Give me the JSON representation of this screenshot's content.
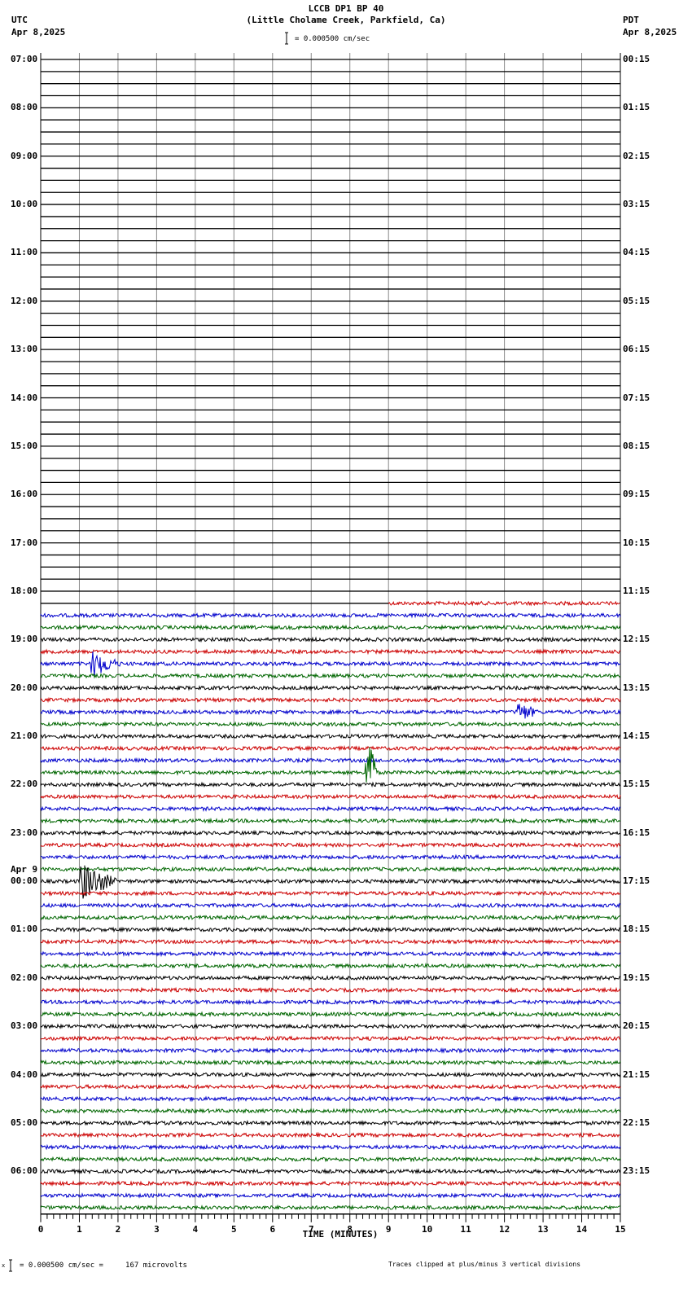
{
  "header": {
    "title": "LCCB DP1 BP 40",
    "subtitle": "(Little Cholame Creek, Parkfield, Ca)",
    "left_tz": "UTC",
    "left_date": "Apr 8,2025",
    "right_tz": "PDT",
    "right_date": "Apr 8,2025",
    "scale": "= 0.000500 cm/sec"
  },
  "footer": {
    "scale": "= 0.000500 cm/sec =     167 microvolts",
    "scale_prefix": "x",
    "clip_note": "Traces clipped at plus/minus 3 vertical divisions"
  },
  "chart_data": {
    "type": "line",
    "title": "LCCB DP1 BP 40",
    "xlabel": "TIME (MINUTES)",
    "xlim": [
      0,
      15
    ],
    "x_ticks": [
      "0",
      "1",
      "2",
      "3",
      "4",
      "5",
      "6",
      "7",
      "8",
      "9",
      "10",
      "11",
      "12",
      "13",
      "14",
      "15"
    ],
    "rows_per_hour": 4,
    "total_rows": 96,
    "left_labels": [
      "07:00",
      "08:00",
      "09:00",
      "10:00",
      "11:00",
      "12:00",
      "13:00",
      "14:00",
      "15:00",
      "16:00",
      "17:00",
      "18:00",
      "19:00",
      "20:00",
      "21:00",
      "22:00",
      "23:00",
      "00:00",
      "01:00",
      "02:00",
      "03:00",
      "04:00",
      "05:00",
      "06:00"
    ],
    "date_change_label": "Apr 9",
    "date_change_hour_index": 17,
    "right_labels": [
      "00:15",
      "01:15",
      "02:15",
      "03:15",
      "04:15",
      "05:15",
      "06:15",
      "07:15",
      "08:15",
      "09:15",
      "10:15",
      "11:15",
      "12:15",
      "13:15",
      "14:15",
      "15:15",
      "16:15",
      "17:15",
      "18:15",
      "19:15",
      "20:15",
      "21:15",
      "22:15",
      "23:15"
    ],
    "trace_colors": [
      "#000000",
      "#cc0000",
      "#0000cc",
      "#006600"
    ],
    "data_start": {
      "row": 45,
      "minute": 9
    },
    "events": [
      {
        "row": 59,
        "minute": 8.4,
        "amplitude": 3,
        "duration_min": 0.3,
        "label": "local event"
      },
      {
        "row": 68,
        "minute": 1.0,
        "amplitude": 0.8,
        "duration_min": 1.0,
        "label": "burst"
      },
      {
        "row": 50,
        "minute": 1.3,
        "amplitude": 0.5,
        "duration_min": 0.8,
        "label": "burst"
      },
      {
        "row": 54,
        "minute": 12.3,
        "amplitude": 0.4,
        "duration_min": 0.6,
        "label": "burst"
      }
    ]
  }
}
